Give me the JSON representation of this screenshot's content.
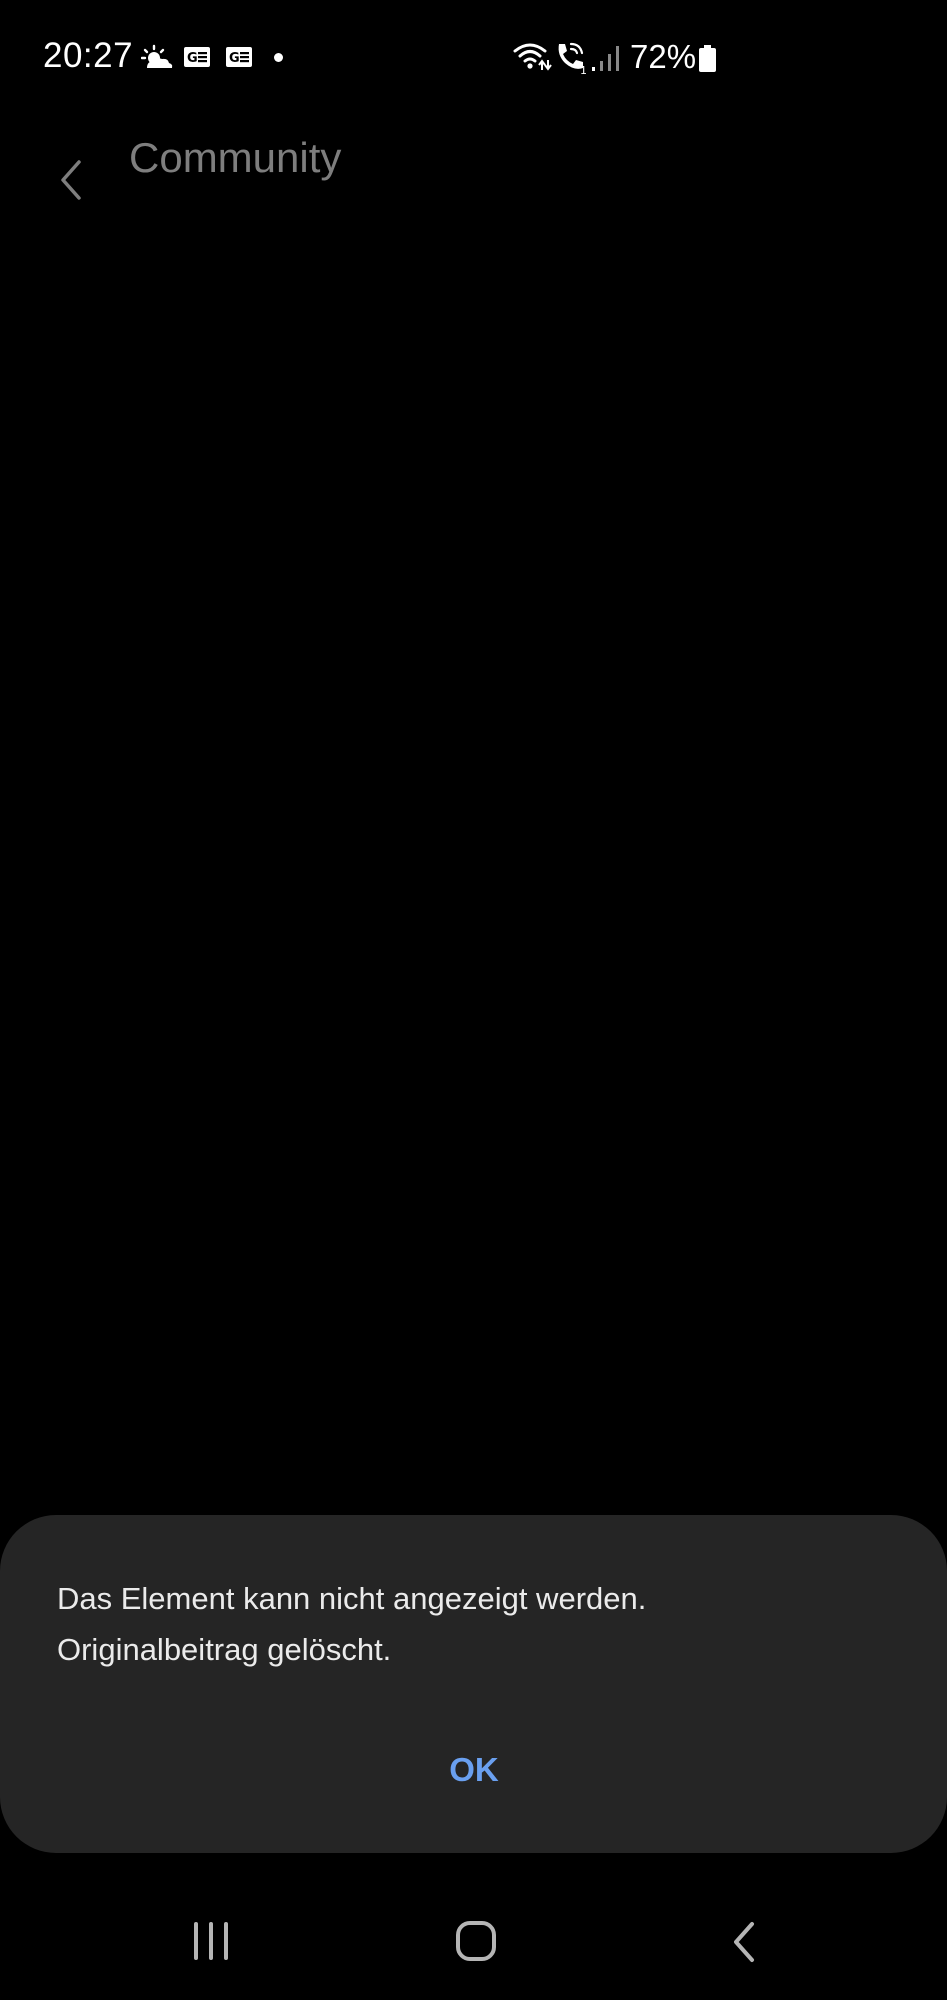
{
  "status_bar": {
    "time": "20:27",
    "battery": "72%",
    "icons": [
      "weather-icon",
      "news-icon",
      "news-icon",
      "dot-icon",
      "wifi-icon",
      "wifi-call-icon",
      "signal-icon",
      "battery-icon"
    ]
  },
  "app_bar": {
    "title": "Community",
    "back_icon": "chevron-left-icon"
  },
  "dialog": {
    "message_line1": "Das Element kann nicht angezeigt werden.",
    "message_line2": "Originalbeitrag gelöscht.",
    "ok_label": "OK",
    "accent_color": "#6aa0f0"
  },
  "nav_bar": {
    "icons": [
      "recents-icon",
      "home-icon",
      "back-icon"
    ]
  },
  "colors": {
    "background": "#000000",
    "dialog_background": "#252525",
    "title_color": "#7e7e7e"
  }
}
